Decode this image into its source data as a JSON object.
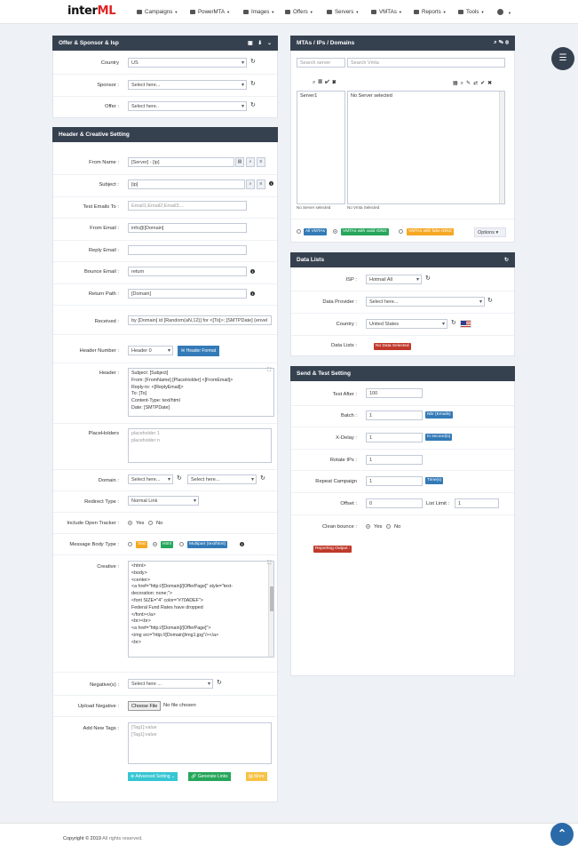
{
  "brand": {
    "logo_prefix": "inter",
    "logo_suffix": "ML"
  },
  "nav": {
    "items": [
      {
        "label": "Campaigns",
        "icon": "envelope-icon"
      },
      {
        "label": "PowerMTA",
        "icon": "cogs-icon"
      },
      {
        "label": "Images",
        "icon": "image-icon"
      },
      {
        "label": "Offers",
        "icon": "bullhorn-icon"
      },
      {
        "label": "Servers",
        "icon": "server-icon"
      },
      {
        "label": "VMTAs",
        "icon": "send-icon"
      },
      {
        "label": "Reports",
        "icon": "bar-chart-icon"
      },
      {
        "label": "Tools",
        "icon": "wrench-icon"
      },
      {
        "label": "",
        "icon": "settings-icon"
      }
    ]
  },
  "offer_panel": {
    "title": "Offer & Sponsor & Isp",
    "country_label": "Country",
    "country_value": "US",
    "sponsor_label": "Sponsor :",
    "sponsor_value": "Select here...",
    "offer_label": "Offer :",
    "offer_value": "Select here.."
  },
  "header_panel": {
    "title": "Header & Creative Setting",
    "from_name_label": "From Name :",
    "from_name_value": "[Server] - [ip]",
    "subject_label": "Subject :",
    "subject_value": "[ip]",
    "test_emails_label": "Test Emails To :",
    "test_emails_placeholder": "Email1;Email2;Email3....",
    "from_email_label": "From Email :",
    "from_email_value": "info@[Domain]",
    "reply_email_label": "Reply Email :",
    "bounce_email_label": "Bounce Email :",
    "bounce_email_value": "return",
    "return_path_label": "Return Path :",
    "return_path_value": "[Domain]",
    "received_label": "Received :",
    "received_value": "by [Domain] id [Random(aN,12)] for <[To]>; [SMTPDate] (envel",
    "header_number_label": "Header Number :",
    "header_number_value": "Header 0",
    "header_format_btn": "Header Format",
    "header_label": "Header :",
    "header_lines": [
      "Subject: [Subject]",
      "From: [FromName] [PlaceHolder] <[FromEmail]>",
      "Reply-to: <[ReplyEmail]>",
      "To: [To]",
      "Content-Type: text/html",
      "Date: [SMTPDate]"
    ],
    "placeholders_label": "PlaceHolders",
    "placeholders_lines": [
      "placeholder 1",
      "placeholder n"
    ],
    "domain_label": "Domain :",
    "domain_value_1": "Select here...",
    "domain_value_2": "Select here...",
    "redirect_label": "Redirect Type :",
    "redirect_value": "Normal Link",
    "open_tracker_label": "Include Open Tracker :",
    "open_yes": "Yes",
    "open_no": "No",
    "body_type_label": "Message Body Type :",
    "body_text": "Text",
    "body_html": "Html",
    "body_multipart": "Multipart (text/html)",
    "creative_label": "Creative :",
    "creative_lines": [
      "<html>",
      "<body>",
      "<center>",
      "<a href=\"http://[Domain]/[OfferPage]\" style=\"text-",
      "decoration: none;\">",
      "<font SIZE=\"4\" color=\"#70ADEF\">",
      "Federal Fund Rates have dropped",
      "</font></a>",
      "<br><br>",
      "<a href=\"http://[Domain]/[OfferPage]\">",
      "<img src=\"http://[Domain]/img1.jpg\"/></a>",
      "<br>"
    ],
    "negative_label": "Negative(s) :",
    "negative_value": "Select here ...",
    "upload_label": "Upload Negative :",
    "choose_file": "Choose File",
    "no_file": "No file chosen",
    "tags_label": "Add New Tags :",
    "tags_lines": [
      "[Tag1]:value",
      "[Tag1]:value"
    ],
    "advanced_btn": "Advanced Setting",
    "generate_btn": "Generate Links",
    "more_btn": "More"
  },
  "mtas_panel": {
    "title": "MTAs / IPs / Domains",
    "search_server_placeholder": "Search server",
    "search_vmta_placeholder": "Search Vmta",
    "servers": [
      "Server1"
    ],
    "no_server": "No Server selected",
    "footer_left": "No Server selected",
    "footer_right": "No Vmta Selected",
    "all_vmtas": "All VMTAs",
    "valid_rdns": "VMTAs with valid rDNS",
    "fake_rdns": "VMTAs with fake rDNS",
    "options_btn": "Options"
  },
  "data_panel": {
    "title": "Data Lists",
    "isp_label": "ISP :",
    "isp_value": "Hotmail All",
    "provider_label": "Data Provider :",
    "provider_value": "Select here...",
    "country_label": "Country :",
    "country_value": "United States",
    "lists_label": "Data Lists :",
    "no_data": "No Data Selected"
  },
  "send_panel": {
    "title": "Send & Test Setting",
    "test_after_label": "Test After :",
    "test_after_value": "100",
    "batch_label": "Batch :",
    "batch_value": "1",
    "batch_badge": "Nbr (Emails)",
    "xdelay_label": "X-Delay :",
    "xdelay_value": "1",
    "xdelay_badge": "In second(s)",
    "rotate_label": "Rotate IPs :",
    "rotate_value": "1",
    "repeat_label": "Repeat Campaign",
    "repeat_value": "1",
    "repeat_badge": "Time(s)",
    "offset_label": "Offset :",
    "offset_value": "0",
    "list_limit_label": "List Limit :",
    "list_limit_value": "1",
    "clean_label": "Clean bounce :",
    "clean_yes": "Yes",
    "clean_no": "No",
    "reporting_badge": "Reporting Output :"
  },
  "footer": {
    "year_text": "Copyright © 2019",
    "rights": " All rights reserved."
  },
  "colors": {
    "header_bg": "#364150",
    "badge_blue": "#337ab7",
    "badge_green": "#26a65b",
    "badge_orange": "#f7a823",
    "badge_red": "#c0392b",
    "cyan": "#36c6d3"
  }
}
